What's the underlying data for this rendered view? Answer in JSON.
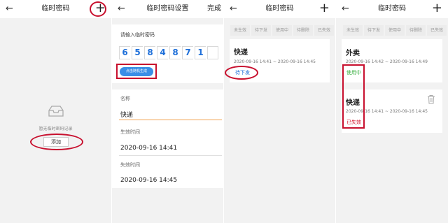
{
  "screen1": {
    "title": "临时密码",
    "empty_text": "暂无临时密码记录",
    "add_label": "添加"
  },
  "screen2": {
    "title": "临时密码设置",
    "done_label": "完成",
    "prompt": "请输入临时密码",
    "digits": [
      "6",
      "5",
      "8",
      "4",
      "8",
      "7",
      "1",
      ""
    ],
    "random_button": "点击随机生成",
    "name_label": "名称",
    "name_value": "快递",
    "start_label": "生效时间",
    "start_value": "2020-09-16 14:41",
    "end_label": "失效时间",
    "end_value": "2020-09-16 14:45"
  },
  "screen3": {
    "title": "临时密码",
    "filters": [
      "未生效",
      "待下发",
      "使用中",
      "待删除",
      "已失效"
    ],
    "record": {
      "name": "快递",
      "period": "2020-09-16 14:41 ~ 2020-09-16 14:45",
      "status": "待下发"
    }
  },
  "screen4": {
    "title": "临时密码",
    "filters": [
      "未生效",
      "待下发",
      "使用中",
      "待删除",
      "已失效"
    ],
    "records": [
      {
        "name": "外卖",
        "period": "2020-09-16 14:42 ~ 2020-09-16 14:49",
        "status": "使用中"
      },
      {
        "name": "快递",
        "period": "2020-09-16 14:41 ~ 2020-09-16 14:45",
        "status": "已失效"
      }
    ]
  },
  "icons": {
    "back": "←",
    "plus": "+",
    "trash": "trash-icon",
    "inbox": "inbox-icon"
  },
  "colors": {
    "accent_blue": "#3a8ee6",
    "digit_blue": "#1e6fd9",
    "annotation_red": "#c8102e",
    "status_pending": "#1e6fd9",
    "status_active": "#3cb043",
    "status_expired": "#d0021b"
  }
}
